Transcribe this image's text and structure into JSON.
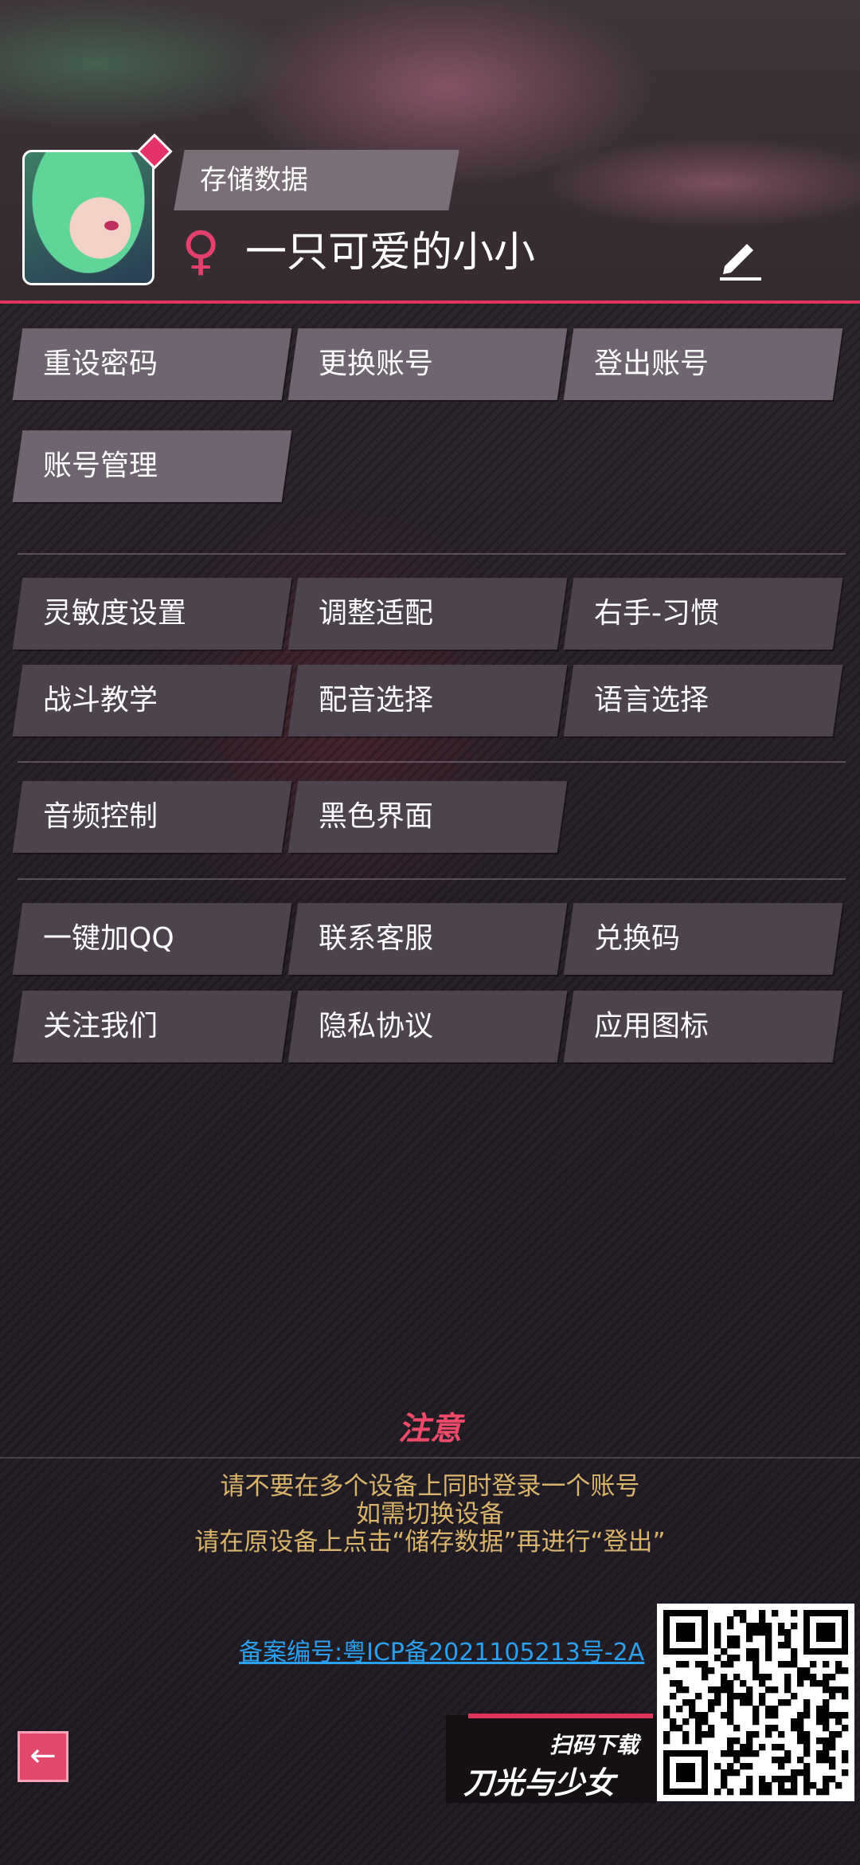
{
  "profile": {
    "tag": "存储数据",
    "gender_symbol": "♀",
    "username": "一只可爱的小小"
  },
  "account_buttons": [
    "重设密码",
    "更换账号",
    "登出账号",
    "账号管理"
  ],
  "settings_buttons": [
    "灵敏度设置",
    "调整适配",
    "右手-习惯",
    "战斗教学",
    "配音选择",
    "语言选择"
  ],
  "display_buttons": [
    "音频控制",
    "黑色界面"
  ],
  "support_buttons": [
    "一键加QQ",
    "联系客服",
    "兑换码",
    "关注我们",
    "隐私协议",
    "应用图标"
  ],
  "notice": {
    "title": "注意",
    "lines": [
      "请不要在多个设备上同时登录一个账号",
      "如需切换设备",
      "请在原设备上点击“储存数据”再进行“登出”"
    ]
  },
  "icp": "备案编号:粤ICP备2021105213号-2A",
  "back": "←",
  "promo": {
    "scan": "扫码下载",
    "title": "刀光与少女"
  },
  "colors": {
    "accent": "#e0345a",
    "notice_text": "#d9b46a",
    "link": "#2aa0ee"
  },
  "icons": {
    "edit": "pencil-icon",
    "back": "back-arrow-icon",
    "badge": "diamond-badge-icon"
  }
}
